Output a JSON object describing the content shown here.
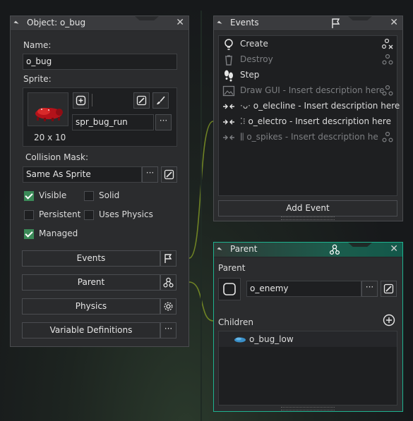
{
  "object_panel": {
    "title": "Object: o_bug",
    "name_label": "Name:",
    "name_value": "o_bug",
    "sprite_label": "Sprite:",
    "sprite_size": "20 x 10",
    "sprite_name": "spr_bug_run",
    "collision_label": "Collision Mask:",
    "collision_value": "Same As Sprite",
    "checkboxes": {
      "visible": {
        "label": "Visible",
        "checked": true
      },
      "solid": {
        "label": "Solid",
        "checked": false
      },
      "persistent": {
        "label": "Persistent",
        "checked": false
      },
      "uses_physics": {
        "label": "Uses Physics",
        "checked": false
      },
      "managed": {
        "label": "Managed",
        "checked": true
      }
    },
    "buttons": {
      "events": "Events",
      "parent": "Parent",
      "physics": "Physics",
      "variable_definitions": "Variable Definitions"
    },
    "dots": "···"
  },
  "events_panel": {
    "title": "Events",
    "items": [
      {
        "label": "Create",
        "icon": "lightbulb-icon",
        "enabled": true
      },
      {
        "label": "Destroy",
        "icon": "trash-icon",
        "enabled": false
      },
      {
        "label": "Step",
        "icon": "footsteps-icon",
        "enabled": true
      },
      {
        "label": "Draw GUI - Insert description here",
        "icon": "image-icon",
        "enabled": false
      },
      {
        "label": "o_elecline - Insert description here",
        "icon": "collision-icon",
        "enabled": true
      },
      {
        "label": "o_electro - Insert description here",
        "icon": "collision-icon",
        "enabled": true
      },
      {
        "label": "o_spikes - Insert description he",
        "icon": "collision-icon",
        "enabled": false
      }
    ],
    "add_event": "Add Event"
  },
  "parent_panel": {
    "title": "Parent",
    "parent_label": "Parent",
    "parent_value": "o_enemy",
    "children_label": "Children",
    "children": [
      "o_bug_low"
    ]
  },
  "colors": {
    "accent_green": "#3b8a58",
    "teal_header": "#15584a",
    "teal_border": "#1fb28f",
    "link_line": "#7a8c26"
  }
}
